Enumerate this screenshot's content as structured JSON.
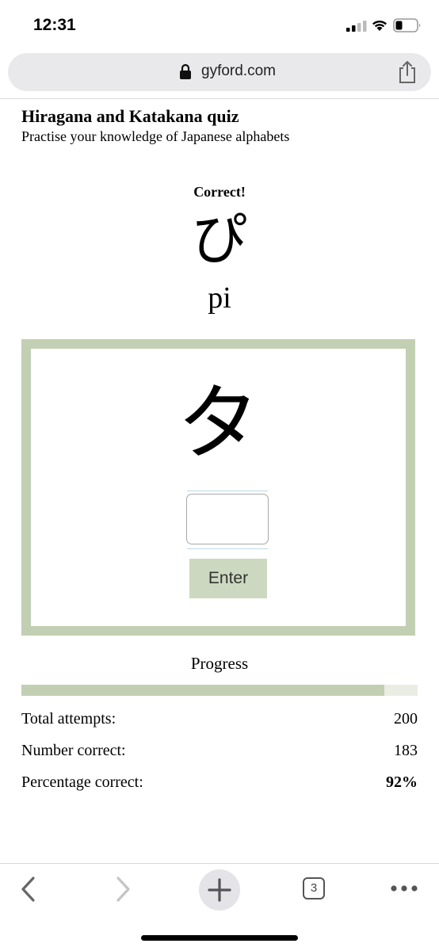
{
  "status_bar": {
    "time": "12:31",
    "icons": [
      "cellular-signal-icon",
      "wifi-icon",
      "battery-icon"
    ]
  },
  "browser": {
    "url": "gyford.com",
    "icons": {
      "lock": "lock-icon",
      "share": "share-icon"
    },
    "toolbar": {
      "tab_count": "3",
      "icons": [
        "back-icon",
        "forward-icon",
        "plus-icon",
        "tabs-icon",
        "more-icon"
      ]
    }
  },
  "page": {
    "title": "Hiragana and Katakana quiz",
    "subtitle": "Practise your knowledge of Japanese alphabets"
  },
  "feedback": {
    "status": "Correct!",
    "character": "ぴ",
    "romaji": "pi"
  },
  "quiz": {
    "character": "タ",
    "answer_value": "",
    "enter_label": "Enter"
  },
  "progress": {
    "heading": "Progress",
    "fraction": 0.915,
    "stats": [
      {
        "label": "Total attempts:",
        "value": "200"
      },
      {
        "label": "Number correct:",
        "value": "183"
      },
      {
        "label": "Percentage correct:",
        "value": "92%"
      }
    ]
  },
  "colors": {
    "accent_green": "#c2cfb2",
    "button_green": "#ccd9c0",
    "progress_track": "#e9ede4"
  }
}
